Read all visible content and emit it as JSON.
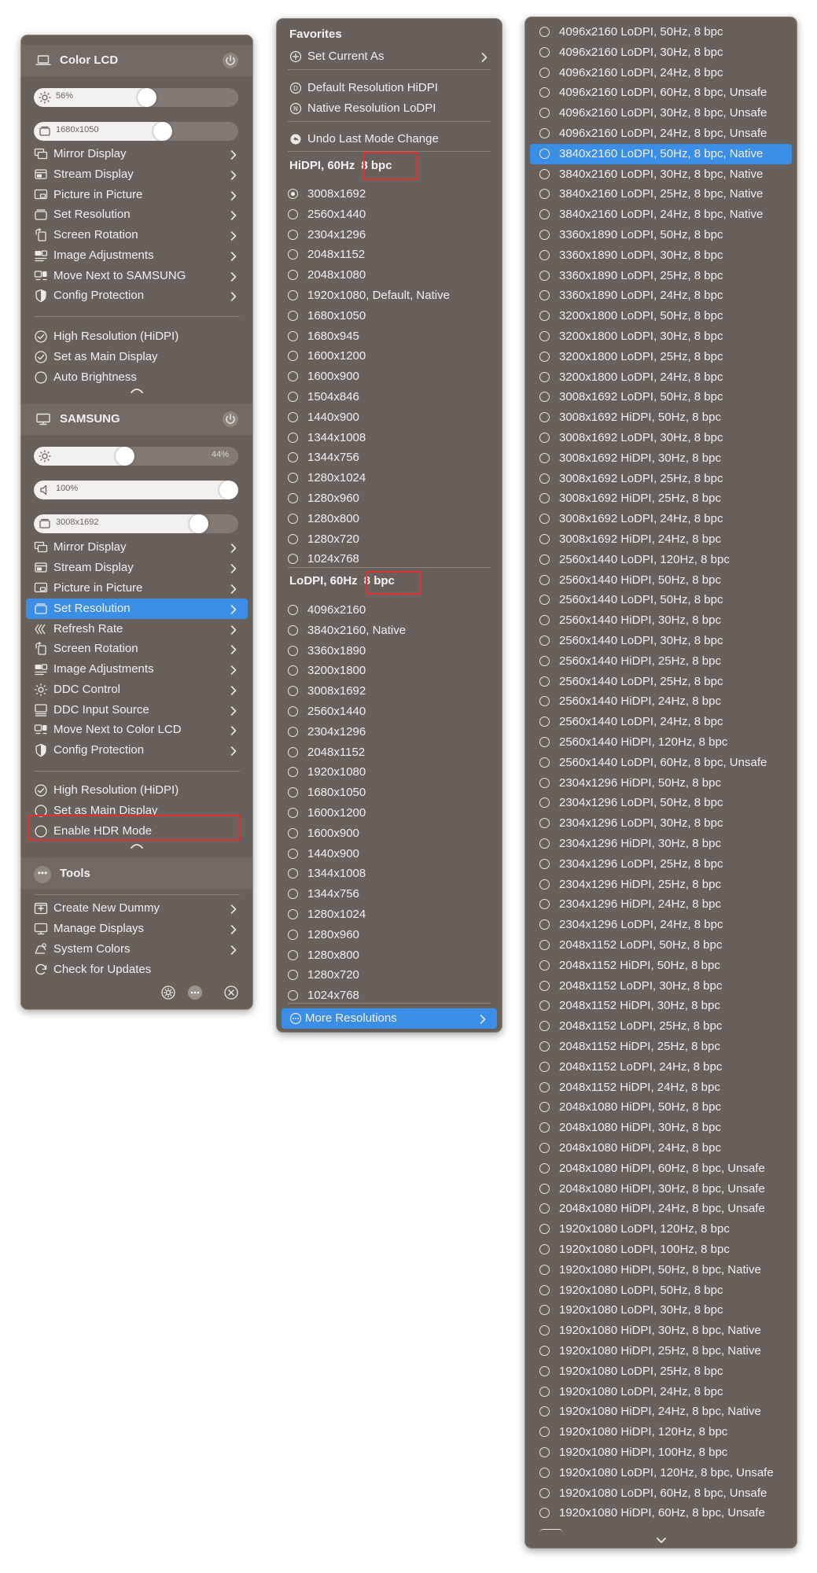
{
  "panel1": {
    "color_lcd": {
      "title": "Color LCD",
      "brightness": 56,
      "brightness_label": "56%",
      "resolution_label": "1680x1050",
      "resolution_fill": 0.645,
      "menu": [
        "Mirror Display",
        "Stream Display",
        "Picture in Picture",
        "Set Resolution",
        "Screen Rotation",
        "Image Adjustments",
        "Move Next to SAMSUNG",
        "Config Protection"
      ],
      "toggles": [
        {
          "label": "High Resolution (HiDPI)",
          "icon": "checkmark-circle-icon"
        },
        {
          "label": "Set as Main Display",
          "icon": "checkmark-circle-icon"
        },
        {
          "label": "Auto Brightness",
          "icon": "empty-circle-icon"
        }
      ]
    },
    "samsung": {
      "title": "SAMSUNG",
      "brightness": 44,
      "brightness_label": "44%",
      "volume": 100,
      "volume_label": "100%",
      "resolution_label": "3008x1692",
      "resolution_fill": 0.84,
      "menu": [
        "Mirror Display",
        "Stream Display",
        "Picture in Picture",
        "Set Resolution",
        "Refresh Rate",
        "Screen Rotation",
        "Image Adjustments",
        "DDC Control",
        "DDC Input Source",
        "Move Next to Color LCD",
        "Config Protection"
      ],
      "selected_menu": "Set Resolution",
      "toggles": [
        {
          "label": "High Resolution (HiDPI)",
          "icon": "checkmark-circle-icon"
        },
        {
          "label": "Set as Main Display",
          "icon": "empty-circle-icon"
        },
        {
          "label": "Enable HDR Mode",
          "icon": "empty-circle-icon"
        }
      ]
    },
    "tools": {
      "title": "Tools",
      "menu": [
        {
          "label": "Create New Dummy",
          "chevron": true
        },
        {
          "label": "Manage Displays",
          "chevron": true
        },
        {
          "label": "System Colors",
          "chevron": true
        },
        {
          "label": "Check for Updates",
          "chevron": false
        }
      ]
    }
  },
  "panel2": {
    "favorites_title": "Favorites",
    "set_current_as": "Set Current As",
    "default_res": "Default Resolution HiDPI",
    "native_res": "Native Resolution LoDPI",
    "undo": "Undo Last Mode Change",
    "hidpi_title": "HiDPI, 60Hz",
    "hidpi_badge": "8 bpc",
    "hidpi_items": [
      "3008x1692",
      "2560x1440",
      "2304x1296",
      "2048x1152",
      "2048x1080",
      "1920x1080, Default, Native",
      "1680x1050",
      "1680x945",
      "1600x1200",
      "1600x900",
      "1504x846",
      "1440x900",
      "1344x1008",
      "1344x756",
      "1280x1024",
      "1280x960",
      "1280x800",
      "1280x720",
      "1024x768"
    ],
    "hidpi_selected": 0,
    "lodpi_title": "LoDPI, 60Hz",
    "lodpi_badge": "8 bpc",
    "lodpi_items": [
      "4096x2160",
      "3840x2160, Native",
      "3360x1890",
      "3200x1800",
      "3008x1692",
      "2560x1440",
      "2304x1296",
      "2048x1152",
      "1920x1080",
      "1680x1050",
      "1600x1200",
      "1600x900",
      "1440x900",
      "1344x1008",
      "1344x756",
      "1280x1024",
      "1280x960",
      "1280x800",
      "1280x720",
      "1024x768"
    ],
    "more": "More Resolutions"
  },
  "panel3": {
    "selected": 6,
    "items": [
      "4096x2160 LoDPI, 50Hz, 8 bpc",
      "4096x2160 LoDPI, 30Hz, 8 bpc",
      "4096x2160 LoDPI, 24Hz, 8 bpc",
      "4096x2160 LoDPI, 60Hz, 8 bpc, Unsafe",
      "4096x2160 LoDPI, 30Hz, 8 bpc, Unsafe",
      "4096x2160 LoDPI, 24Hz, 8 bpc, Unsafe",
      "3840x2160 LoDPI, 50Hz, 8 bpc, Native",
      "3840x2160 LoDPI, 30Hz, 8 bpc, Native",
      "3840x2160 LoDPI, 25Hz, 8 bpc, Native",
      "3840x2160 LoDPI, 24Hz, 8 bpc, Native",
      "3360x1890 LoDPI, 50Hz, 8 bpc",
      "3360x1890 LoDPI, 30Hz, 8 bpc",
      "3360x1890 LoDPI, 25Hz, 8 bpc",
      "3360x1890 LoDPI, 24Hz, 8 bpc",
      "3200x1800 LoDPI, 50Hz, 8 bpc",
      "3200x1800 LoDPI, 30Hz, 8 bpc",
      "3200x1800 LoDPI, 25Hz, 8 bpc",
      "3200x1800 LoDPI, 24Hz, 8 bpc",
      "3008x1692 LoDPI, 50Hz, 8 bpc",
      "3008x1692 HiDPI, 50Hz, 8 bpc",
      "3008x1692 LoDPI, 30Hz, 8 bpc",
      "3008x1692 HiDPI, 30Hz, 8 bpc",
      "3008x1692 LoDPI, 25Hz, 8 bpc",
      "3008x1692 HiDPI, 25Hz, 8 bpc",
      "3008x1692 LoDPI, 24Hz, 8 bpc",
      "3008x1692 HiDPI, 24Hz, 8 bpc",
      "2560x1440 LoDPI, 120Hz, 8 bpc",
      "2560x1440 HiDPI, 50Hz, 8 bpc",
      "2560x1440 LoDPI, 50Hz, 8 bpc",
      "2560x1440 HiDPI, 30Hz, 8 bpc",
      "2560x1440 LoDPI, 30Hz, 8 bpc",
      "2560x1440 HiDPI, 25Hz, 8 bpc",
      "2560x1440 LoDPI, 25Hz, 8 bpc",
      "2560x1440 HiDPI, 24Hz, 8 bpc",
      "2560x1440 LoDPI, 24Hz, 8 bpc",
      "2560x1440 HiDPI, 120Hz, 8 bpc",
      "2560x1440 LoDPI, 60Hz, 8 bpc, Unsafe",
      "2304x1296 HiDPI, 50Hz, 8 bpc",
      "2304x1296 LoDPI, 50Hz, 8 bpc",
      "2304x1296 LoDPI, 30Hz, 8 bpc",
      "2304x1296 HiDPI, 30Hz, 8 bpc",
      "2304x1296 LoDPI, 25Hz, 8 bpc",
      "2304x1296 HiDPI, 25Hz, 8 bpc",
      "2304x1296 HiDPI, 24Hz, 8 bpc",
      "2304x1296 LoDPI, 24Hz, 8 bpc",
      "2048x1152 LoDPI, 50Hz, 8 bpc",
      "2048x1152 HiDPI, 50Hz, 8 bpc",
      "2048x1152 LoDPI, 30Hz, 8 bpc",
      "2048x1152 HiDPI, 30Hz, 8 bpc",
      "2048x1152 LoDPI, 25Hz, 8 bpc",
      "2048x1152 HiDPI, 25Hz, 8 bpc",
      "2048x1152 LoDPI, 24Hz, 8 bpc",
      "2048x1152 HiDPI, 24Hz, 8 bpc",
      "2048x1080 HiDPI, 50Hz, 8 bpc",
      "2048x1080 HiDPI, 30Hz, 8 bpc",
      "2048x1080 HiDPI, 24Hz, 8 bpc",
      "2048x1080 HiDPI, 60Hz, 8 bpc, Unsafe",
      "2048x1080 HiDPI, 30Hz, 8 bpc, Unsafe",
      "2048x1080 HiDPI, 24Hz, 8 bpc, Unsafe",
      "1920x1080 LoDPI, 120Hz, 8 bpc",
      "1920x1080 LoDPI, 100Hz, 8 bpc",
      "1920x1080 HiDPI, 50Hz, 8 bpc, Native",
      "1920x1080 LoDPI, 50Hz, 8 bpc",
      "1920x1080 LoDPI, 30Hz, 8 bpc",
      "1920x1080 HiDPI, 30Hz, 8 bpc, Native",
      "1920x1080 HiDPI, 25Hz, 8 bpc, Native",
      "1920x1080 LoDPI, 25Hz, 8 bpc",
      "1920x1080 LoDPI, 24Hz, 8 bpc",
      "1920x1080 HiDPI, 24Hz, 8 bpc, Native",
      "1920x1080 HiDPI, 120Hz, 8 bpc",
      "1920x1080 HiDPI, 100Hz, 8 bpc",
      "1920x1080 LoDPI, 120Hz, 8 bpc, Unsafe",
      "1920x1080 LoDPI, 60Hz, 8 bpc, Unsafe",
      "1920x1080 HiDPI, 60Hz, 8 bpc, Unsafe"
    ]
  },
  "colors": {
    "panel": "#67605b",
    "header": "#716a65",
    "selected": "#3a8ee6",
    "highlight_box": "#e3302f"
  }
}
